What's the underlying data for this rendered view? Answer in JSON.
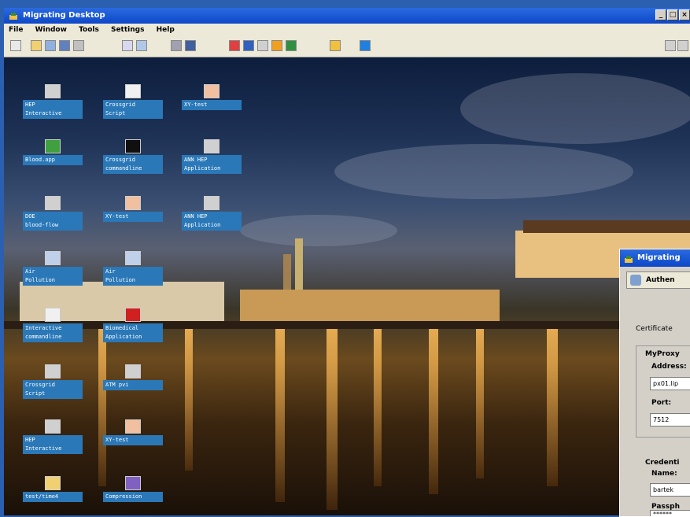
{
  "window": {
    "title": "Migrating Desktop",
    "min": "_",
    "max": "□",
    "close": "×"
  },
  "menu": [
    "File",
    "Window",
    "Tools",
    "Settings",
    "Help"
  ],
  "desktop_icons": [
    {
      "label": "HEP\nInteractive"
    },
    {
      "label": "Crossgrid\nScript"
    },
    {
      "label": "XY-test"
    },
    {
      "label": "Blood.app"
    },
    {
      "label": "Crossgrid\ncommandline"
    },
    {
      "label": "ANN HEP\nApplication"
    },
    {
      "label": "DOE\nblood-flow"
    },
    {
      "label": "XY-test"
    },
    {
      "label": "ANN HEP\nApplication"
    },
    {
      "label": "Air\nPollution"
    },
    {
      "label": "Air\nPollution"
    },
    {
      "label": "Interactive\ncommandline"
    },
    {
      "label": "Biomedical\nApplication"
    },
    {
      "label": "Crossgrid\nScript"
    },
    {
      "label": "ATM pvi"
    },
    {
      "label": "HEP\nInteractive"
    },
    {
      "label": "XY-test"
    },
    {
      "label": "test/time4"
    },
    {
      "label": "Compression"
    }
  ],
  "dialog": {
    "title": "Migrating",
    "tab": "Authen",
    "certificate": "Certificate",
    "myproxy": "MyProxy",
    "address_label": "Address:",
    "address_value": "px01.lip",
    "port_label": "Port:",
    "port_value": "7512",
    "credentials": "Credenti",
    "name_label": "Name:",
    "name_value": "bartek",
    "passphrase_label": "Passph",
    "passphrase_value": "******"
  }
}
